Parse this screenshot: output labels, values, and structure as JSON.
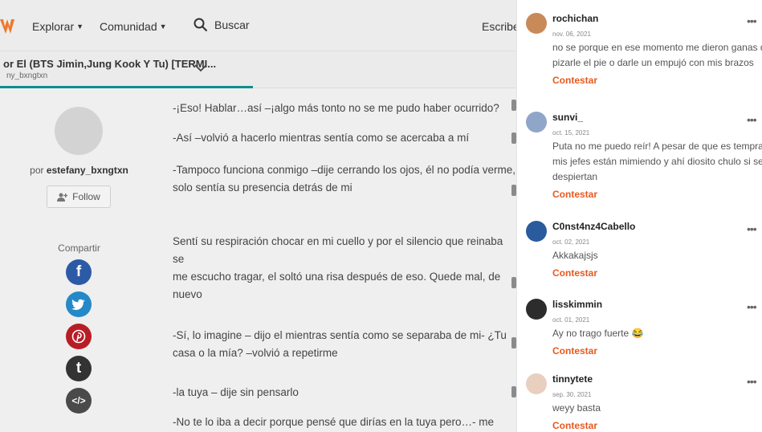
{
  "header": {
    "nav_explore": "Explorar",
    "nav_community": "Comunidad",
    "search_label": "Buscar",
    "write_label": "Escribe"
  },
  "story": {
    "title": "or El (BTS Jimin,Jung Kook Y Tu) [TERMI...",
    "author_short": "ny_bxngtxn",
    "reading_progress": 0.49
  },
  "author_card": {
    "by_prefix": "por",
    "author": "estefany_bxngtxn",
    "follow_label": "Follow",
    "share_label": "Compartir",
    "share_icons": [
      "facebook-icon",
      "twitter-icon",
      "pinterest-icon",
      "tumblr-icon",
      "embed-icon"
    ]
  },
  "paragraphs": [
    {
      "lines": [
        "-¡Eso! Hablar…así –¡algo más tonto no se me pudo haber ocurrido?"
      ]
    },
    {
      "lines": [
        "-Así –volvió a hacerlo mientras sentía como se acercaba a mí"
      ]
    },
    {
      "lines": [
        "-Tampoco funciona conmigo –dije cerrando los ojos, él no podía verme,",
        "solo sentía su presencia detrás de mi"
      ]
    },
    {
      "lines": [
        "Sentí su respiración chocar en mi cuello y por el silencio que reinaba se",
        "me escucho tragar, el soltó una risa después de eso. Quede mal, de",
        "nuevo"
      ]
    },
    {
      "lines": [
        "-Sí, lo imagine – dijo el mientras sentía como se separaba de mi- ¿Tu",
        "casa o la mía? –volvió a repetirme"
      ]
    },
    {
      "lines": [
        "-la tuya – dije sin pensarlo"
      ]
    },
    {
      "lines": [
        "-No te lo iba a decir porque pensé que dirías en la tuya pero…- me"
      ]
    }
  ],
  "comments": [
    {
      "user": "rochichan",
      "date": "nov. 06, 2021",
      "lines": [
        "no se porque en ese momento me dieron ganas de",
        "pizarle el pie o darle un empujó con mis brazos"
      ],
      "reply": "Contestar",
      "more": "•••",
      "avatar_color": "#c98a5a"
    },
    {
      "user": "sunvi_",
      "date": "oct. 15, 2021",
      "lines": [
        "Puta no me puedo reír! A pesar de que es temprano",
        "mis jefes están mimiendo y ahí diosito chulo si se",
        "despiertan"
      ],
      "reply": "Contestar",
      "more": "•••",
      "avatar_color": "#8fa6c9"
    },
    {
      "user": "C0nst4nz4Cabello",
      "date": "oct. 02, 2021",
      "lines": [
        "Akkakajsjs"
      ],
      "reply": "Contestar",
      "more": "•••",
      "avatar_color": "#2a5b9c"
    },
    {
      "user": "lisskimmin",
      "date": "oct. 01, 2021",
      "lines": [
        "Ay no trago fuerte 😂"
      ],
      "reply": "Contestar",
      "more": "•••",
      "avatar_color": "#2c2c2c"
    },
    {
      "user": "tinnytete",
      "date": "sep. 30, 2021",
      "lines": [
        "weyy basta"
      ],
      "reply": "Contestar",
      "more": "•••",
      "avatar_color": "#e8cfc0"
    }
  ],
  "colors": {
    "brand": "#f0782c",
    "reply": "#e9591e",
    "progress": "#0f8d8d"
  }
}
